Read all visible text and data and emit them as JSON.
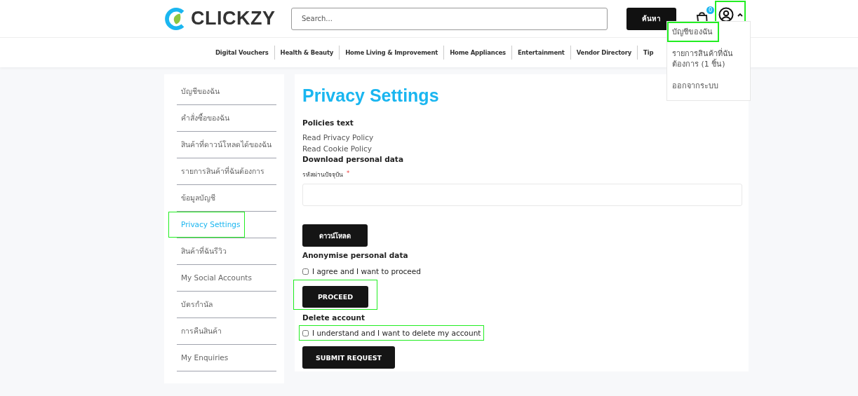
{
  "header": {
    "logo": "CLICKZY",
    "search": {
      "placeholder": "Search..."
    },
    "search_button": "ค้นหา",
    "cart_count": "0",
    "account_button": {
      "expanded": true,
      "highlighted": true
    }
  },
  "account_menu": [
    {
      "label": "บัญชีของฉัน",
      "highlighted": true
    },
    {
      "label": "รายการสินค้าที่ฉันต้องการ (1 ชิ้น)",
      "highlighted": false
    },
    {
      "label": "ออกจากระบบ",
      "highlighted": false
    }
  ],
  "nav": [
    "Digital Vouchers",
    "Health & Beauty",
    "Home Living & Improvement",
    "Home Appliances",
    "Entertainment",
    "Vendor Directory",
    "Tip"
  ],
  "sidebar": {
    "items": [
      {
        "label": "บัญชีของฉัน",
        "selected": false,
        "highlighted": false
      },
      {
        "label": "คำสั่งซื้อของฉัน",
        "selected": false,
        "highlighted": false
      },
      {
        "label": "สินค้าที่ดาวน์โหลดได้ของฉัน",
        "selected": false,
        "highlighted": false
      },
      {
        "label": "รายการสินค้าที่ฉันต้องการ",
        "selected": false,
        "highlighted": false
      },
      {
        "label": "ข้อมูลบัญชี",
        "selected": false,
        "highlighted": false
      },
      {
        "label": "Privacy Settings",
        "selected": true,
        "highlighted": true
      },
      {
        "label": "สินค้าที่ฉันรีวิว",
        "selected": false,
        "highlighted": false
      },
      {
        "label": "My Social Accounts",
        "selected": false,
        "highlighted": false
      },
      {
        "label": "บัตรกำนัล",
        "selected": false,
        "highlighted": false
      },
      {
        "label": "การคืนสินค้า",
        "selected": false,
        "highlighted": false
      },
      {
        "label": "My Enquiries",
        "selected": false,
        "highlighted": false
      }
    ]
  },
  "content": {
    "title": "Privacy Settings",
    "policies": {
      "heading": "Policies text",
      "links": [
        "Read Privacy Policy",
        "Read Cookie Policy"
      ]
    },
    "download": {
      "heading": "Download personal data",
      "field_label": "รหัสผ่านปัจจุบัน",
      "required_mark": "*",
      "button": "ดาวน์โหลด"
    },
    "anonymise": {
      "heading": "Anonymise personal data",
      "checkbox": {
        "label": "I agree and I want to proceed",
        "checked": false,
        "highlighted": false
      },
      "button": {
        "label": "PROCEED",
        "highlighted": true
      }
    },
    "delete": {
      "heading": "Delete account",
      "checkbox": {
        "label": "I understand and I want to delete my account",
        "checked": false,
        "highlighted": true
      },
      "button": {
        "label": "SUBMIT REQUEST",
        "highlighted": false
      }
    }
  }
}
